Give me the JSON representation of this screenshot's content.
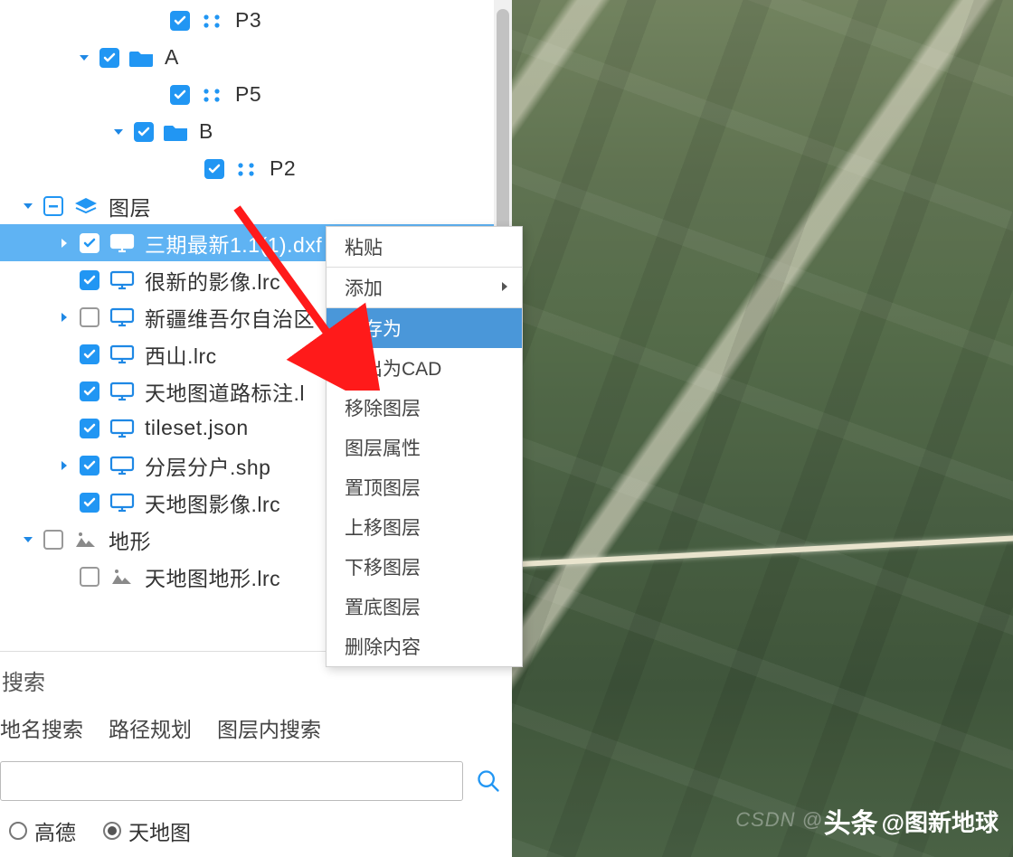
{
  "tree": {
    "rows": [
      {
        "indent": 160,
        "tw": "none",
        "cb": "checked",
        "icon": "points",
        "label": "P3",
        "sel": false
      },
      {
        "indent": 82,
        "tw": "down",
        "cb": "checked",
        "icon": "folder",
        "label": "A",
        "sel": false
      },
      {
        "indent": 160,
        "tw": "none",
        "cb": "checked",
        "icon": "points",
        "label": "P5",
        "sel": false
      },
      {
        "indent": 120,
        "tw": "down",
        "cb": "checked",
        "icon": "folder",
        "label": "B",
        "sel": false
      },
      {
        "indent": 198,
        "tw": "none",
        "cb": "checked",
        "icon": "points",
        "label": "P2",
        "sel": false
      },
      {
        "indent": 20,
        "tw": "down",
        "cb": "mixed",
        "icon": "layers",
        "label": "图层",
        "sel": false
      },
      {
        "indent": 60,
        "tw": "right",
        "cb": "checked",
        "icon": "monitor",
        "label": "三期最新1.1(1).dxf",
        "sel": true
      },
      {
        "indent": 60,
        "tw": "none",
        "cb": "checked",
        "icon": "monitor",
        "label": "很新的影像.lrc",
        "sel": false
      },
      {
        "indent": 60,
        "tw": "right",
        "cb": "unchecked",
        "icon": "monitor",
        "label": "新疆维吾尔自治区",
        "sel": false
      },
      {
        "indent": 60,
        "tw": "none",
        "cb": "checked",
        "icon": "monitor",
        "label": "西山.lrc",
        "sel": false
      },
      {
        "indent": 60,
        "tw": "none",
        "cb": "checked",
        "icon": "monitor",
        "label": "天地图道路标注.l",
        "sel": false
      },
      {
        "indent": 60,
        "tw": "none",
        "cb": "checked",
        "icon": "monitor",
        "label": "tileset.json",
        "sel": false
      },
      {
        "indent": 60,
        "tw": "right",
        "cb": "checked",
        "icon": "monitor",
        "label": "分层分户.shp",
        "sel": false
      },
      {
        "indent": 60,
        "tw": "none",
        "cb": "checked",
        "icon": "monitor",
        "label": "天地图影像.lrc",
        "sel": false
      },
      {
        "indent": 20,
        "tw": "down",
        "cb": "unchecked",
        "icon": "terrain",
        "label": "地形",
        "sel": false
      },
      {
        "indent": 60,
        "tw": "none",
        "cb": "unchecked",
        "icon": "terrain",
        "label": "天地图地形.lrc",
        "sel": false
      }
    ]
  },
  "context_menu": {
    "items": [
      {
        "label": "粘贴",
        "hover": false,
        "has_sub": false,
        "sep_after": true
      },
      {
        "label": "添加",
        "hover": false,
        "has_sub": true,
        "sep_after": true
      },
      {
        "label": "另存为",
        "hover": true,
        "has_sub": false,
        "sep_after": false
      },
      {
        "label": "导出为CAD",
        "hover": false,
        "has_sub": false,
        "sep_after": false
      },
      {
        "label": "移除图层",
        "hover": false,
        "has_sub": false,
        "sep_after": false
      },
      {
        "label": "图层属性",
        "hover": false,
        "has_sub": false,
        "sep_after": false
      },
      {
        "label": "置顶图层",
        "hover": false,
        "has_sub": false,
        "sep_after": false
      },
      {
        "label": "上移图层",
        "hover": false,
        "has_sub": false,
        "sep_after": false
      },
      {
        "label": "下移图层",
        "hover": false,
        "has_sub": false,
        "sep_after": false
      },
      {
        "label": "置底图层",
        "hover": false,
        "has_sub": false,
        "sep_after": false
      },
      {
        "label": "删除内容",
        "hover": false,
        "has_sub": false,
        "sep_after": false
      }
    ]
  },
  "search": {
    "title": "搜索",
    "tabs": [
      "地名搜索",
      "路径规划",
      "图层内搜索"
    ],
    "value": "",
    "placeholder": "",
    "provider_options": [
      "高德",
      "天地图"
    ],
    "provider_selected": 1
  },
  "watermarks": {
    "csdn": "CSDN @",
    "toutiao_prefix": "头条",
    "toutiao_at": "@图新地球"
  }
}
